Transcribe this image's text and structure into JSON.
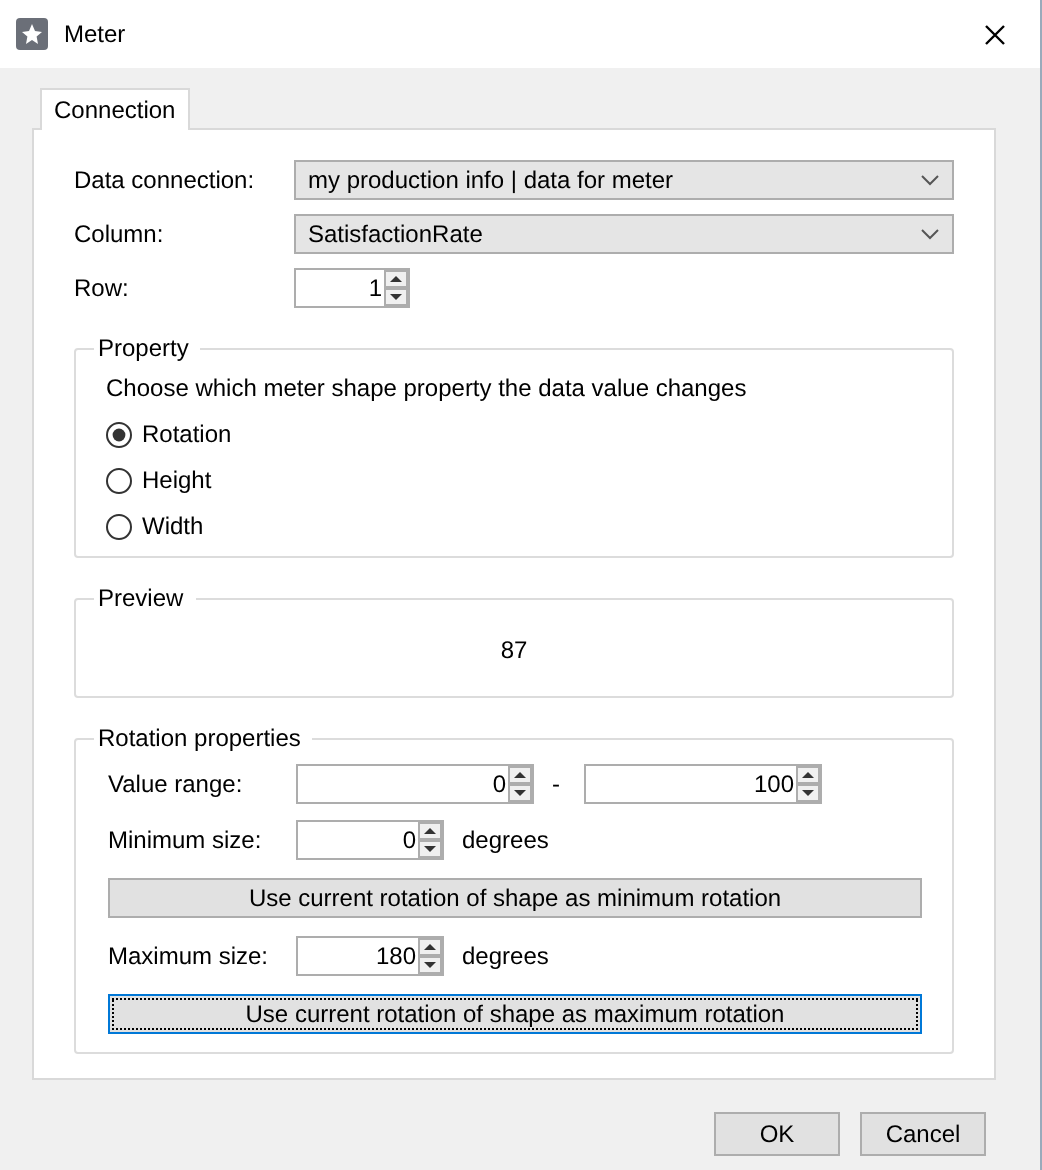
{
  "window": {
    "title": "Meter"
  },
  "tabs": [
    {
      "label": "Connection",
      "selected": true
    }
  ],
  "connection": [
    {
      "kind": "dropdown",
      "label": "Data connection:",
      "value": "my production info | data for meter"
    },
    {
      "kind": "dropdown",
      "label": "Column:",
      "value": "SatisfactionRate"
    },
    {
      "kind": "spin",
      "label": "Row:",
      "value": "1"
    }
  ],
  "property": {
    "title": "Property",
    "description": "Choose which meter shape property the data value changes",
    "options": [
      {
        "label": "Rotation",
        "selected": true
      },
      {
        "label": "Height",
        "selected": false
      },
      {
        "label": "Width",
        "selected": false
      }
    ]
  },
  "preview": {
    "title": "Preview",
    "value": "87"
  },
  "rotation_properties": {
    "title": "Rotation properties",
    "rows": [
      {
        "kind": "range",
        "label": "Value range:",
        "min": "0",
        "separator": "-",
        "max": "100"
      },
      {
        "kind": "size",
        "label": "Minimum size:",
        "value": "0",
        "unit": "degrees"
      },
      {
        "kind": "button",
        "label": "Use current rotation of shape as minimum rotation",
        "focused": false
      },
      {
        "kind": "size",
        "label": "Maximum size:",
        "value": "180",
        "unit": "degrees"
      },
      {
        "kind": "button",
        "label": "Use current rotation of shape as maximum rotation",
        "focused": true
      }
    ]
  },
  "buttons": [
    {
      "label": "OK"
    },
    {
      "label": "Cancel"
    }
  ]
}
